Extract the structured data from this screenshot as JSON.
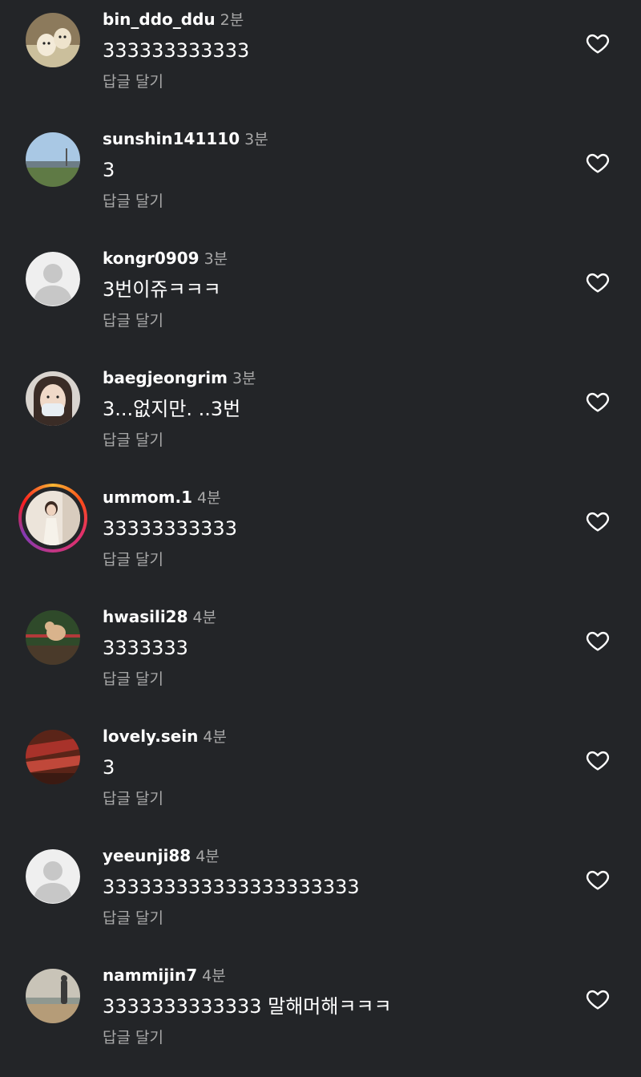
{
  "comments": [
    {
      "username": "bin_ddo_ddu",
      "time": "2분",
      "text": "333333333333",
      "reply_label": "답글 달기",
      "avatar": "dogs-photo"
    },
    {
      "username": "sunshin141110",
      "time": "3분",
      "text": "3",
      "reply_label": "답글 달기",
      "avatar": "sky-landscape-photo"
    },
    {
      "username": "kongr0909",
      "time": "3분",
      "text": "3번이쥬ㅋㅋㅋ",
      "reply_label": "답글 달기",
      "avatar": "default-profile"
    },
    {
      "username": "baegjeongrim",
      "time": "3분",
      "text": "3...없지만. ..3번",
      "reply_label": "답글 달기",
      "avatar": "masked-person-photo"
    },
    {
      "username": "ummom.1",
      "time": "4분",
      "text": "33333333333",
      "reply_label": "답글 달기",
      "avatar": "person-photo-with-story-ring"
    },
    {
      "username": "hwasili28",
      "time": "4분",
      "text": "3333333",
      "reply_label": "답글 달기",
      "avatar": "dog-on-fence-photo"
    },
    {
      "username": "lovely.sein",
      "time": "4분",
      "text": "3",
      "reply_label": "답글 달기",
      "avatar": "red-fabric-photo"
    },
    {
      "username": "yeeunji88",
      "time": "4분",
      "text": "333333333333333333333",
      "reply_label": "답글 달기",
      "avatar": "default-profile"
    },
    {
      "username": "nammijin7",
      "time": "4분",
      "text": "3333333333333 말해머해ㅋㅋㅋ",
      "reply_label": "답글 달기",
      "avatar": "beach-person-photo"
    }
  ],
  "colors": {
    "background": "#232528",
    "username": "#ffffff",
    "secondary_text": "#a8a8a8",
    "icon": "#ffffff"
  },
  "icons": {
    "like": "heart-outline-icon"
  }
}
